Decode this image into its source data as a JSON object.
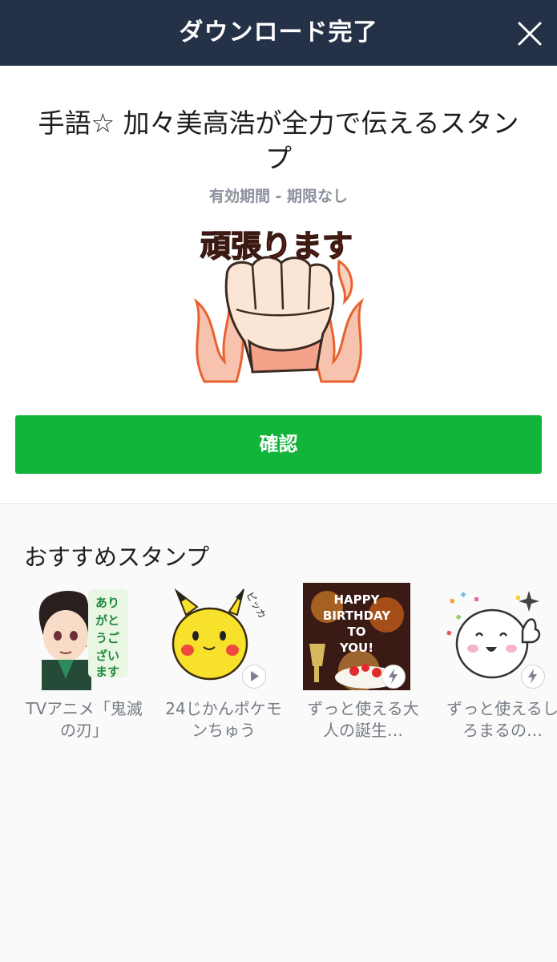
{
  "header": {
    "title": "ダウンロード完了",
    "close_icon": "close-icon"
  },
  "sticker": {
    "title": "手語☆ 加々美高浩が全力で伝えるスタンプ",
    "validity": "有効期間 - 期限なし",
    "preview_text": "頑張ります"
  },
  "confirm": {
    "label": "確認"
  },
  "recommend": {
    "title": "おすすめスタンプ",
    "items": [
      {
        "name": "TVアニメ「鬼滅の刃」",
        "thumb_text": "ありがとうございます",
        "badge": ""
      },
      {
        "name": "24じかんポケモンちゅう",
        "thumb_text": "ピッカ",
        "badge": "play-icon"
      },
      {
        "name": "ずっと使える大人の誕生…",
        "thumb_text": "HAPPY BIRTHDAY TO YOU!",
        "badge": "lightning-icon"
      },
      {
        "name": "ずっと使えるしろまるの…",
        "thumb_text": "",
        "badge": "lightning-icon"
      }
    ]
  },
  "colors": {
    "header_bg": "#253147",
    "confirm_bg": "#11b53a",
    "muted_text": "#8b919c"
  }
}
